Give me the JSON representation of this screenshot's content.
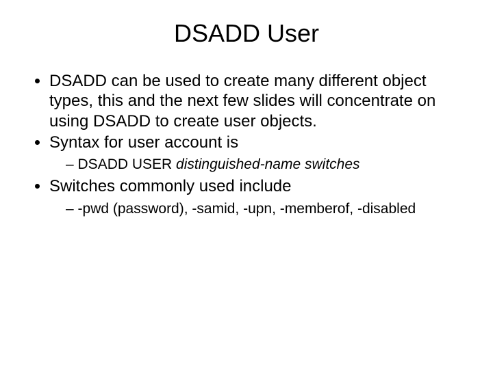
{
  "title": "DSADD User",
  "bullets": {
    "b1": "DSADD can be used to create many different object types, this and the next few slides will concentrate on using DSADD to create user objects.",
    "b2": "Syntax for user account is",
    "b2_sub_prefix": "DSADD USER ",
    "b2_sub_italic": "distinguished-name switches",
    "b3": "Switches commonly used include",
    "b3_sub": "-pwd (password), -samid, -upn, -memberof, -disabled"
  }
}
